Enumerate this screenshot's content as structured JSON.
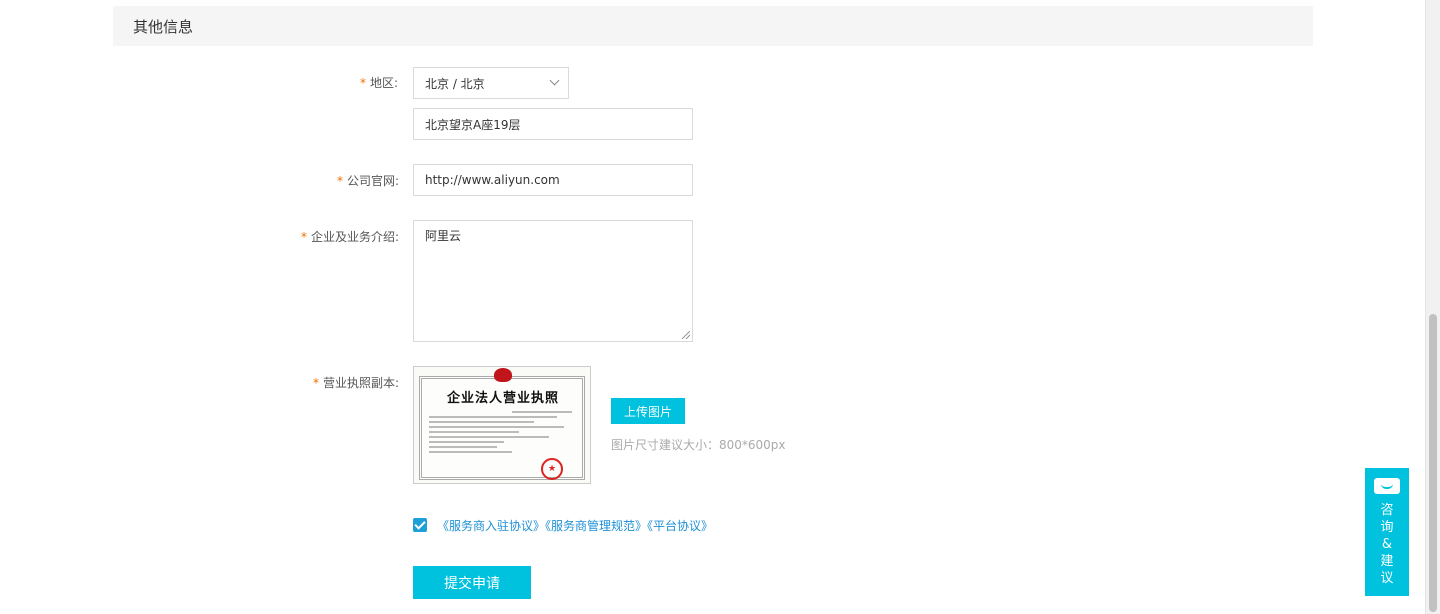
{
  "section": {
    "title": "其他信息"
  },
  "form": {
    "required_mark": "*",
    "region": {
      "label": "地区:",
      "value": "北京 / 北京"
    },
    "address": {
      "value": "北京望京A座19层"
    },
    "website": {
      "label": "公司官网:",
      "value": "http://www.aliyun.com"
    },
    "intro": {
      "label": "企业及业务介绍:",
      "value": "阿里云"
    },
    "license": {
      "label": "营业执照副本:",
      "image_title": "企业法人营业执照",
      "upload_label": "上传图片",
      "hint": "图片尺寸建议大小：800*600px"
    },
    "agreements": {
      "checked": true,
      "links": [
        "《服务商入驻协议》",
        "《服务商管理规范》",
        "《平台协议》"
      ]
    },
    "submit_label": "提交申请"
  },
  "floating": {
    "chars": [
      "咨",
      "询",
      "&",
      "建",
      "议"
    ],
    "icon": "chat-icon"
  },
  "colors": {
    "accent": "#00c1de",
    "required": "#f07000",
    "link": "#1e90d6"
  }
}
